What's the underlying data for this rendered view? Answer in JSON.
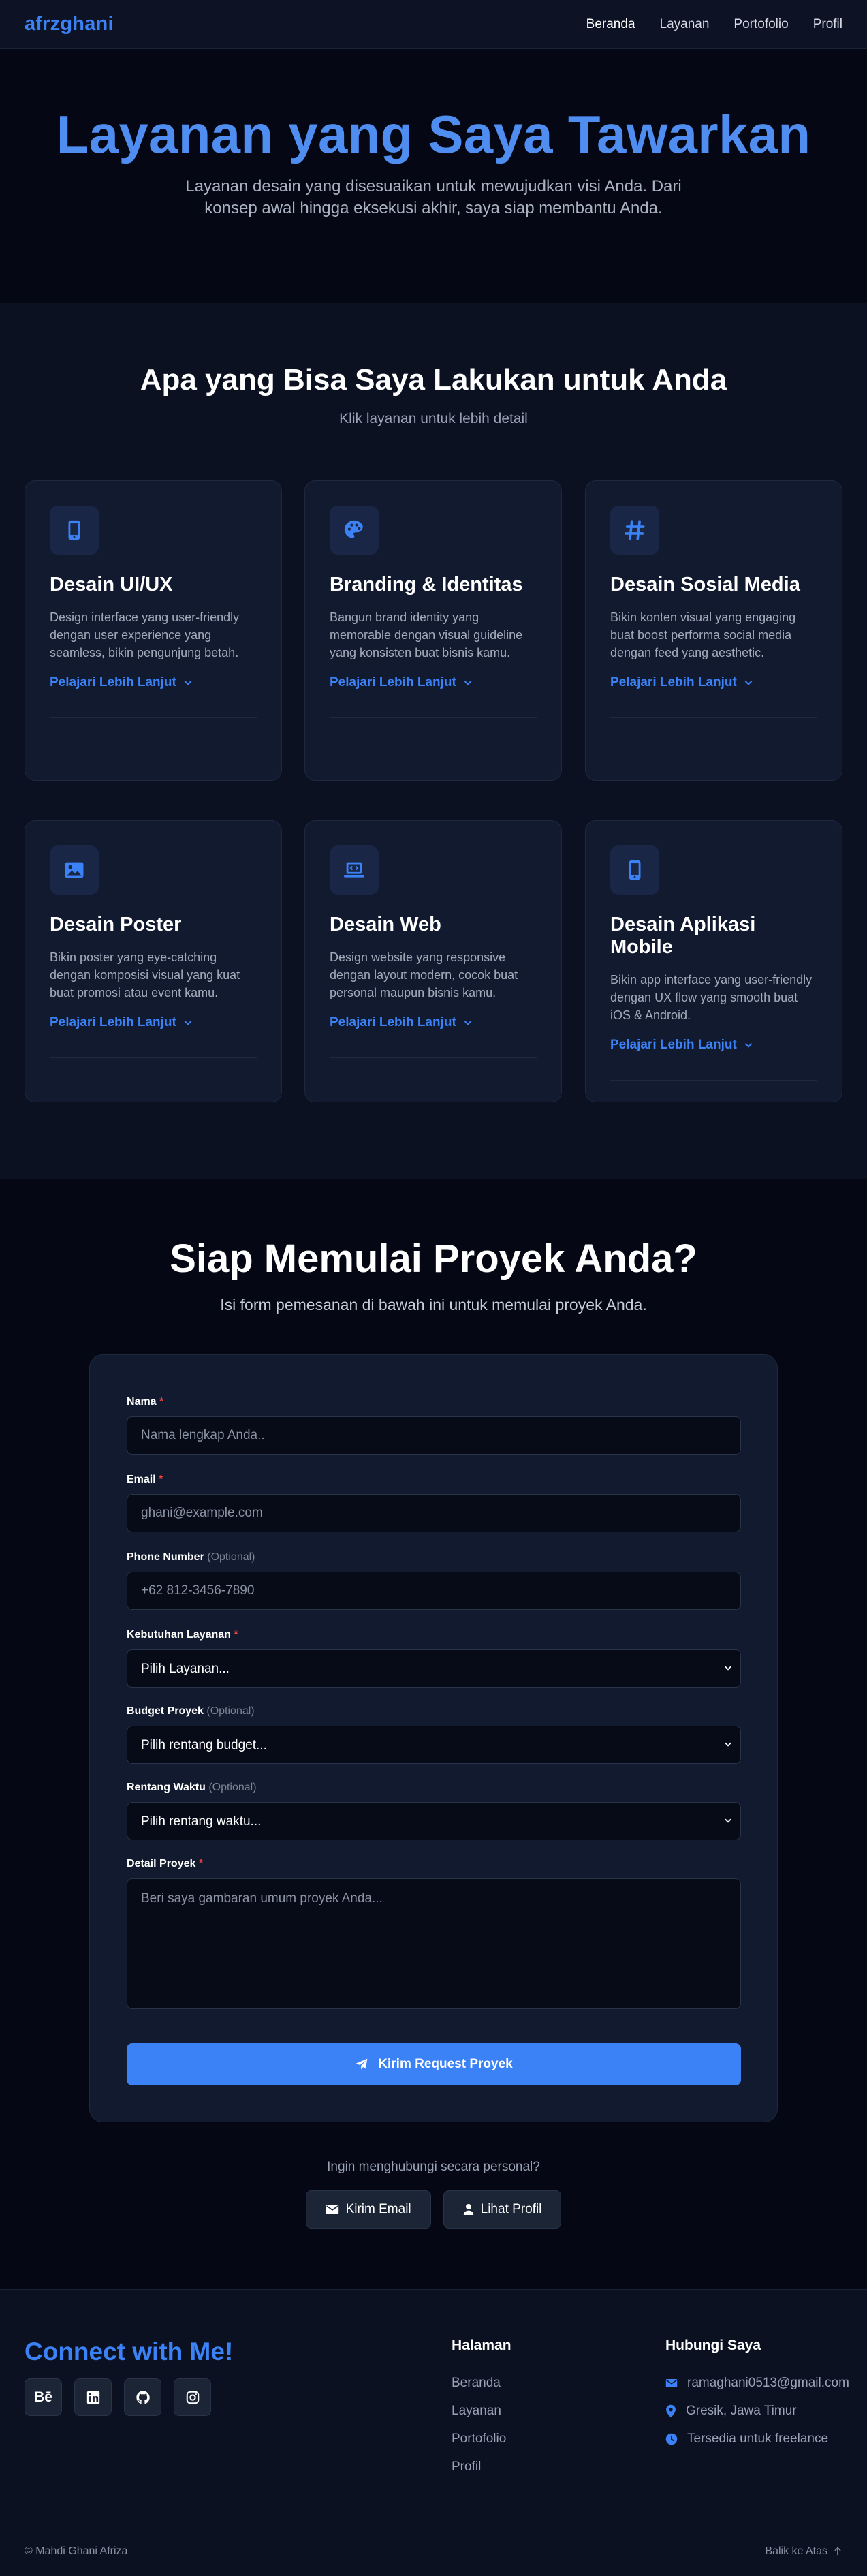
{
  "nav": {
    "brand": "afrzghani",
    "links": [
      "Beranda",
      "Layanan",
      "Portofolio",
      "Profil"
    ]
  },
  "hero": {
    "title": "Layanan yang Saya Tawarkan",
    "subtitle": "Layanan desain yang disesuaikan untuk mewujudkan visi Anda. Dari konsep awal hingga eksekusi akhir, saya siap membantu Anda."
  },
  "services": {
    "title": "Apa yang Bisa Saya Lakukan untuk Anda",
    "subtitle": "Klik layanan untuk lebih detail",
    "more_label": "Pelajari Lebih Lanjut",
    "cards": [
      {
        "icon": "mobile-icon",
        "title": "Desain UI/UX",
        "desc": "Design interface yang user-friendly dengan user experience yang seamless, bikin pengunjung betah."
      },
      {
        "icon": "palette-icon",
        "title": "Branding & Identitas",
        "desc": "Bangun brand identity yang memorable dengan visual guideline yang konsisten buat bisnis kamu."
      },
      {
        "icon": "hashtag-icon",
        "title": "Desain Sosial Media",
        "desc": "Bikin konten visual yang engaging buat boost performa social media dengan feed yang aesthetic."
      },
      {
        "icon": "image-icon",
        "title": "Desain Poster",
        "desc": "Bikin poster yang eye-catching dengan komposisi visual yang kuat buat promosi atau event kamu."
      },
      {
        "icon": "laptop-code-icon",
        "title": "Desain Web",
        "desc": "Design website yang responsive dengan layout modern, cocok buat personal maupun bisnis kamu."
      },
      {
        "icon": "mobile-icon",
        "title": "Desain Aplikasi Mobile",
        "desc": "Bikin app interface yang user-friendly dengan UX flow yang smooth buat iOS & Android."
      }
    ]
  },
  "cta": {
    "title": "Siap Memulai Proyek Anda?",
    "subtitle": "Isi form pemesanan di bawah ini untuk memulai proyek Anda.",
    "form": {
      "name_label": "Nama",
      "name_placeholder": "Nama lengkap Anda..",
      "email_label": "Email",
      "email_placeholder": "ghani@example.com",
      "phone_label": "Phone Number",
      "phone_placeholder": "+62 812-3456-7890",
      "service_label": "Kebutuhan Layanan",
      "service_value": "Pilih Layanan...",
      "budget_label": "Budget Proyek",
      "budget_value": "Pilih rentang budget...",
      "time_label": "Rentang Waktu",
      "time_value": "Pilih rentang waktu...",
      "detail_label": "Detail Proyek",
      "detail_placeholder": "Beri saya gambaran umum proyek Anda...",
      "required_mark": "*",
      "optional_mark": "(Optional)",
      "submit_label": "Kirim Request Proyek"
    },
    "personal_prompt": "Ingin menghubungi secara personal?",
    "email_button": "Kirim Email",
    "profile_button": "Lihat Profil"
  },
  "footer": {
    "connect_title": "Connect with Me!",
    "socials": [
      "behance-icon",
      "linkedin-icon",
      "github-icon",
      "instagram-icon"
    ],
    "behance_text": "Bē",
    "pages_title": "Halaman",
    "pages": [
      "Beranda",
      "Layanan",
      "Portofolio",
      "Profil"
    ],
    "contact_title": "Hubungi Saya",
    "email": "ramaghani0513@gmail.com",
    "location": "Gresik, Jawa Timur",
    "availability": "Tersedia untuk freelance",
    "copyright": "© Mahdi Ghani Afriza",
    "back_to_top": "Balik ke Atas"
  },
  "colors": {
    "accent": "#3b82f6",
    "background": "#050814",
    "card": "#111a2e",
    "required": "#ef4444"
  }
}
